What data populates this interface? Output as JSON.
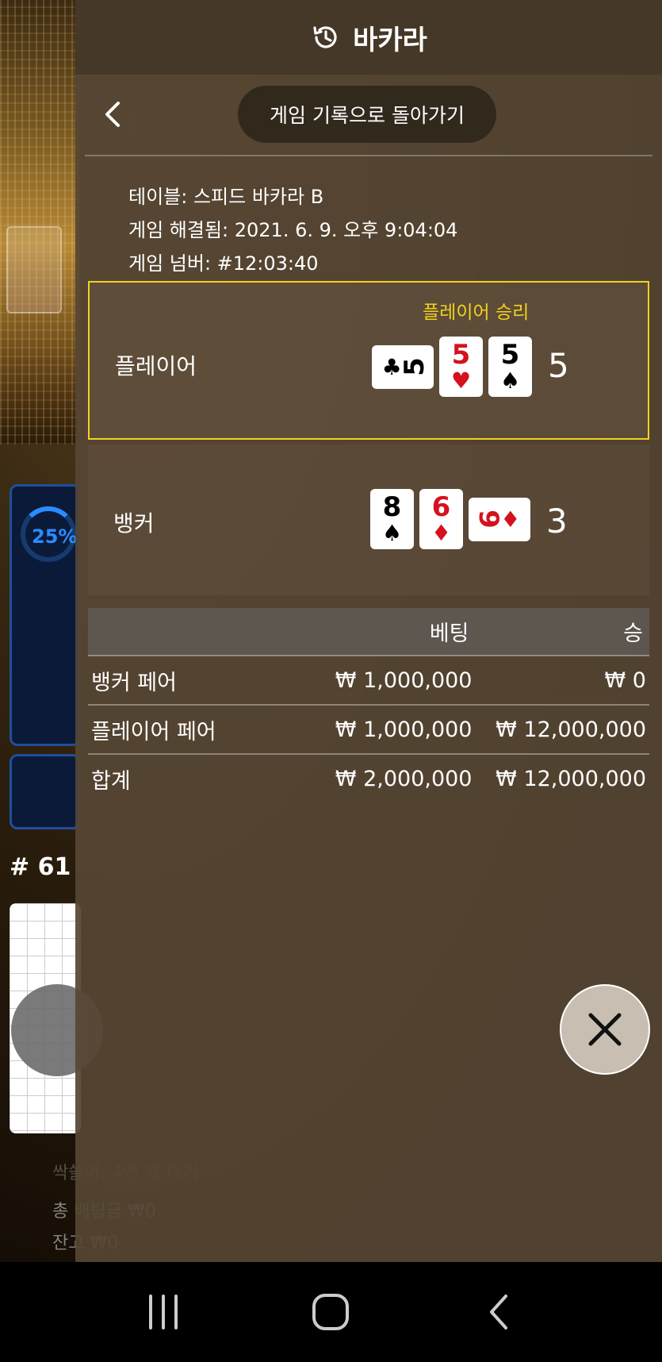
{
  "background": {
    "progress_label": "25%",
    "round_label": "# 61",
    "footer_line1": "싹쓸이: 4연 뱅 대기",
    "footer_line2": "총 배팅금 ₩0",
    "footer_line3": "잔고 ₩0"
  },
  "header": {
    "title": "바카라",
    "icon": "history-icon"
  },
  "nav": {
    "back_icon": "chevron-left-icon",
    "back_to_history_label": "게임 기록으로 돌아가기"
  },
  "game_info": {
    "table": "테이블: 스피드 바카라 B",
    "resolved": "게임 해결됨: 2021. 6. 9. 오후 9:04:04",
    "number": "게임 넘버: #12:03:40"
  },
  "player": {
    "label": "플레이어",
    "result": "플레이어 승리",
    "score": "5",
    "cards": [
      {
        "rank": "5",
        "suit": "♣",
        "color": "black",
        "sideways": true
      },
      {
        "rank": "5",
        "suit": "♥",
        "color": "red",
        "sideways": false
      },
      {
        "rank": "5",
        "suit": "♠",
        "color": "black",
        "sideways": false
      }
    ]
  },
  "banker": {
    "label": "뱅커",
    "score": "3",
    "cards": [
      {
        "rank": "8",
        "suit": "♠",
        "color": "black",
        "sideways": false
      },
      {
        "rank": "6",
        "suit": "♦",
        "color": "red",
        "sideways": false
      },
      {
        "rank": "9",
        "suit": "♦",
        "color": "red",
        "sideways": true
      }
    ]
  },
  "bets": {
    "columns": [
      "",
      "베팅",
      "승"
    ],
    "rows": [
      {
        "name": "뱅커 페어",
        "bet": "₩ 1,000,000",
        "win": "₩ 0"
      },
      {
        "name": "플레이어 페어",
        "bet": "₩ 1,000,000",
        "win": "₩ 12,000,000"
      },
      {
        "name": "합계",
        "bet": "₩ 2,000,000",
        "win": "₩ 12,000,000"
      }
    ]
  },
  "colors": {
    "win_highlight": "#f2d21e",
    "red_suit": "#d4121e"
  }
}
